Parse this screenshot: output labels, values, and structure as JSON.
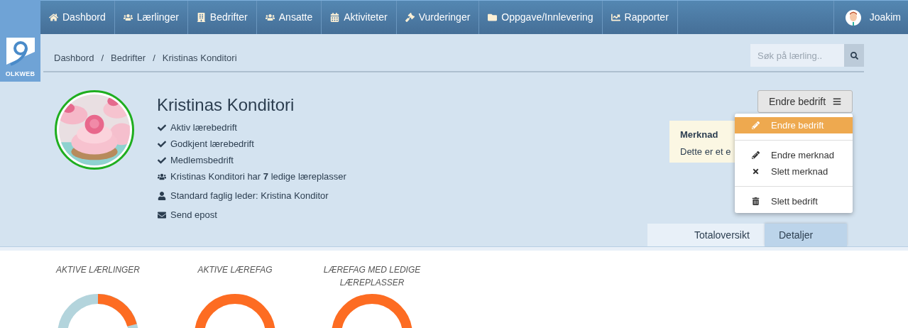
{
  "logo": {
    "text": "OLKWEB"
  },
  "nav": {
    "items": [
      {
        "label": "Dashbord"
      },
      {
        "label": "Lærlinger"
      },
      {
        "label": "Bedrifter"
      },
      {
        "label": "Ansatte"
      },
      {
        "label": "Aktiviteter"
      },
      {
        "label": "Vurderinger"
      },
      {
        "label": "Oppgave/Innlevering"
      },
      {
        "label": "Rapporter"
      }
    ],
    "user": "Joakim"
  },
  "breadcrumb": [
    "Dashbord",
    "Bedrifter",
    "Kristinas Konditori"
  ],
  "breadcrumb_separator": "/",
  "search": {
    "placeholder": "Søk på lærling.."
  },
  "company": {
    "name": "Kristinas Konditori",
    "active": true,
    "facts": [
      {
        "kind": "status",
        "text": "Aktiv lærebedrift"
      },
      {
        "kind": "status",
        "text": "Godkjent lærebedrift"
      },
      {
        "kind": "status",
        "text": "Medlemsbedrift"
      },
      {
        "kind": "vacancies",
        "text": "Kristinas Konditori har **7** ledige læreplasser"
      },
      {
        "kind": "leader",
        "text": "Standard faglig leder: Kristina Konditor"
      },
      {
        "kind": "email",
        "text": "Send epost"
      }
    ]
  },
  "note": {
    "title": "Merknad",
    "text": "Dette er et e"
  },
  "menu_button": {
    "label": "Endre bedrift"
  },
  "menu": {
    "groups": [
      [
        {
          "label": "Endre bedrift",
          "kind": "edit",
          "selected": true
        }
      ],
      [
        {
          "label": "Endre merknad",
          "kind": "edit",
          "selected": false
        },
        {
          "label": "Slett merknad",
          "kind": "remove",
          "selected": false
        }
      ],
      [
        {
          "label": "Slett bedrift",
          "kind": "delete",
          "selected": false
        }
      ]
    ]
  },
  "tabs": [
    {
      "label": "Totaloversikt",
      "selected": true
    },
    {
      "label": "Detaljer",
      "selected": false
    }
  ],
  "stats": [
    {
      "title": "AKTIVE LÆRLINGER"
    },
    {
      "title": "AKTIVE LÆREFAG"
    },
    {
      "title": "LÆREFAG MED LEDIGE LÆREPLASSER"
    }
  ]
}
